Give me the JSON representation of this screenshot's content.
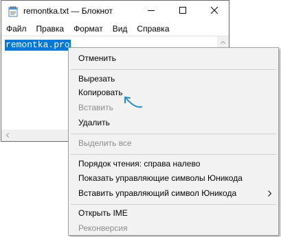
{
  "window": {
    "title": "remontka.txt — Блокнот"
  },
  "menubar": {
    "items": [
      "Файл",
      "Правка",
      "Формат",
      "Вид",
      "Справка"
    ]
  },
  "editor": {
    "text": "remontka.pro"
  },
  "context_menu": {
    "items": [
      {
        "label": "Отменить",
        "enabled": true
      },
      {
        "label": "Вырезать",
        "enabled": true
      },
      {
        "label": "Копировать",
        "enabled": true
      },
      {
        "label": "Вставить",
        "enabled": false
      },
      {
        "label": "Удалить",
        "enabled": true
      },
      {
        "label": "Выделить все",
        "enabled": false
      },
      {
        "label": "Порядок чтения: справа налево",
        "enabled": true
      },
      {
        "label": "Показать управляющие символы Юникода",
        "enabled": true
      },
      {
        "label": "Вставить управляющий символ Юникода",
        "enabled": true,
        "submenu": true
      },
      {
        "label": "Открыть IME",
        "enabled": true
      },
      {
        "label": "Реконверсия",
        "enabled": false
      }
    ]
  },
  "colors": {
    "selection": "#0078d7",
    "annotation_arrow": "#1e8ad6",
    "menu_background": "#f2f2f2",
    "disabled_text": "#8c8c8c"
  },
  "icons": {
    "app": "notepad-icon",
    "minimize": "minimize-icon",
    "maximize": "maximize-icon",
    "close": "close-icon",
    "submenu": "chevron-right-icon",
    "annotation": "curved-arrow-icon"
  }
}
